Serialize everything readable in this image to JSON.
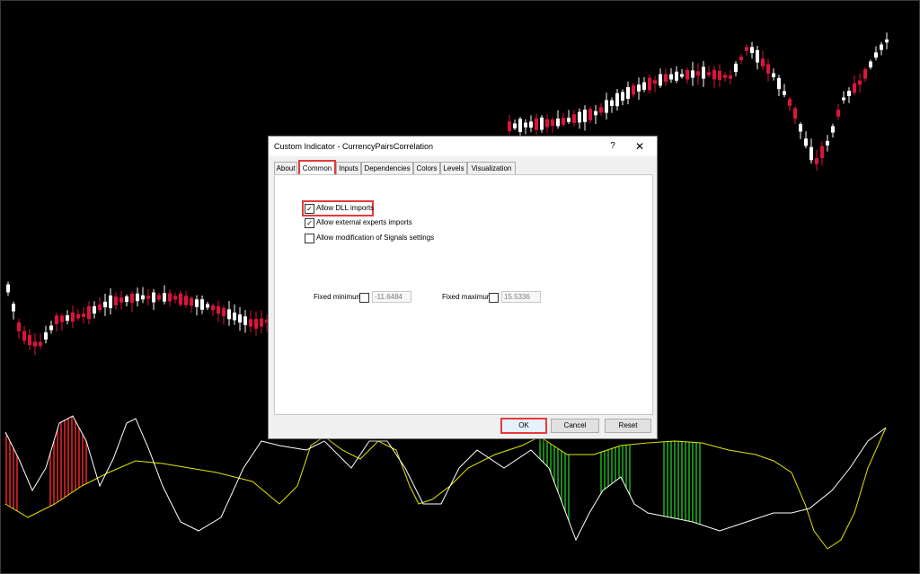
{
  "dialog": {
    "title": "Custom Indicator - CurrencyPairsCorrelation",
    "help_label": "?",
    "close_label": "✕",
    "tabs": [
      {
        "label": "About"
      },
      {
        "label": "Common",
        "active": true
      },
      {
        "label": "Inputs"
      },
      {
        "label": "Dependencies"
      },
      {
        "label": "Colors"
      },
      {
        "label": "Levels"
      },
      {
        "label": "Visualization"
      }
    ],
    "checkboxes": [
      {
        "label": "Allow DLL imports",
        "checked": true
      },
      {
        "label": "Allow external experts imports",
        "checked": true
      },
      {
        "label": "Allow modification of Signals settings",
        "checked": false
      }
    ],
    "fixed_minimum": {
      "label": "Fixed minimum",
      "checked": false,
      "value": "-11.6484"
    },
    "fixed_maximum": {
      "label": "Fixed maximum",
      "checked": false,
      "value": "15.5336"
    },
    "buttons": {
      "ok": "OK",
      "cancel": "Cancel",
      "reset": "Reset"
    },
    "check_mark": "✓"
  },
  "colors": {
    "bull": "#ffffff",
    "bear": "#dc143c",
    "line_white": "#ffffff",
    "line_yellow": "#e6e600",
    "fill_red": "#ff2a2a",
    "fill_green": "#1fbf1f",
    "highlight": "#e33b3b"
  }
}
